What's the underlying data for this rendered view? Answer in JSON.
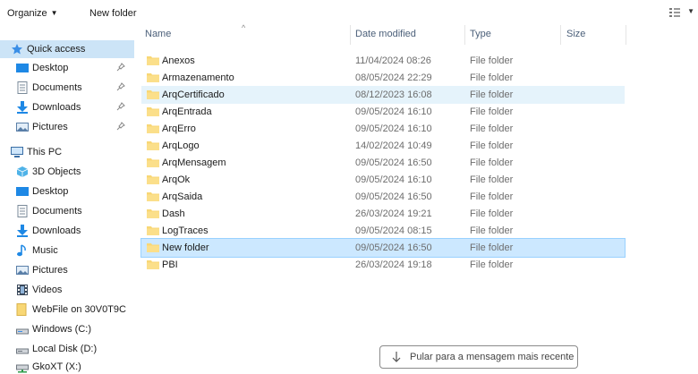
{
  "toolbar": {
    "organize_label": "Organize",
    "new_folder_label": "New folder"
  },
  "columns": {
    "name": "Name",
    "date": "Date modified",
    "type": "Type",
    "size": "Size"
  },
  "nav": {
    "quick_access": {
      "label": "Quick access",
      "items": [
        {
          "label": "Desktop",
          "icon": "desktop-icon",
          "pinned": true
        },
        {
          "label": "Documents",
          "icon": "documents-icon",
          "pinned": true
        },
        {
          "label": "Downloads",
          "icon": "downloads-icon",
          "pinned": true
        },
        {
          "label": "Pictures",
          "icon": "pictures-icon",
          "pinned": true
        }
      ]
    },
    "this_pc": {
      "label": "This PC",
      "items": [
        {
          "label": "3D Objects",
          "icon": "3d-objects-icon"
        },
        {
          "label": "Desktop",
          "icon": "desktop-icon"
        },
        {
          "label": "Documents",
          "icon": "documents-icon"
        },
        {
          "label": "Downloads",
          "icon": "downloads-icon"
        },
        {
          "label": "Music",
          "icon": "music-icon"
        },
        {
          "label": "Pictures",
          "icon": "pictures-icon"
        },
        {
          "label": "Videos",
          "icon": "videos-icon"
        },
        {
          "label": "WebFile on 30V0T9C",
          "icon": "network-folder-icon"
        },
        {
          "label": "Windows (C:)",
          "icon": "drive-icon"
        },
        {
          "label": "Local Disk (D:)",
          "icon": "drive-icon"
        },
        {
          "label": "GkoXT (X:)",
          "icon": "network-drive-icon"
        }
      ]
    }
  },
  "files": [
    {
      "name": "Anexos",
      "date": "11/04/2024 08:26",
      "type": "File folder"
    },
    {
      "name": "Armazenamento",
      "date": "08/05/2024 22:29",
      "type": "File folder"
    },
    {
      "name": "ArqCertificado",
      "date": "08/12/2023 16:08",
      "type": "File folder"
    },
    {
      "name": "ArqEntrada",
      "date": "09/05/2024 16:10",
      "type": "File folder"
    },
    {
      "name": "ArqErro",
      "date": "09/05/2024 16:10",
      "type": "File folder"
    },
    {
      "name": "ArqLogo",
      "date": "14/02/2024 10:49",
      "type": "File folder"
    },
    {
      "name": "ArqMensagem",
      "date": "09/05/2024 16:50",
      "type": "File folder"
    },
    {
      "name": "ArqOk",
      "date": "09/05/2024 16:10",
      "type": "File folder"
    },
    {
      "name": "ArqSaida",
      "date": "09/05/2024 16:50",
      "type": "File folder"
    },
    {
      "name": "Dash",
      "date": "26/03/2024 19:21",
      "type": "File folder"
    },
    {
      "name": "LogTraces",
      "date": "09/05/2024 08:15",
      "type": "File folder"
    },
    {
      "name": "New folder",
      "date": "09/05/2024 16:50",
      "type": "File folder"
    },
    {
      "name": "PBI",
      "date": "26/03/2024 19:18",
      "type": "File folder"
    }
  ],
  "jump_button": {
    "label": "Pular para a mensagem mais recente",
    "icon": "arrow-down-icon"
  },
  "colors": {
    "selection": "#cce8ff",
    "hover": "#e5f3fb",
    "folder": "#f8d775"
  }
}
